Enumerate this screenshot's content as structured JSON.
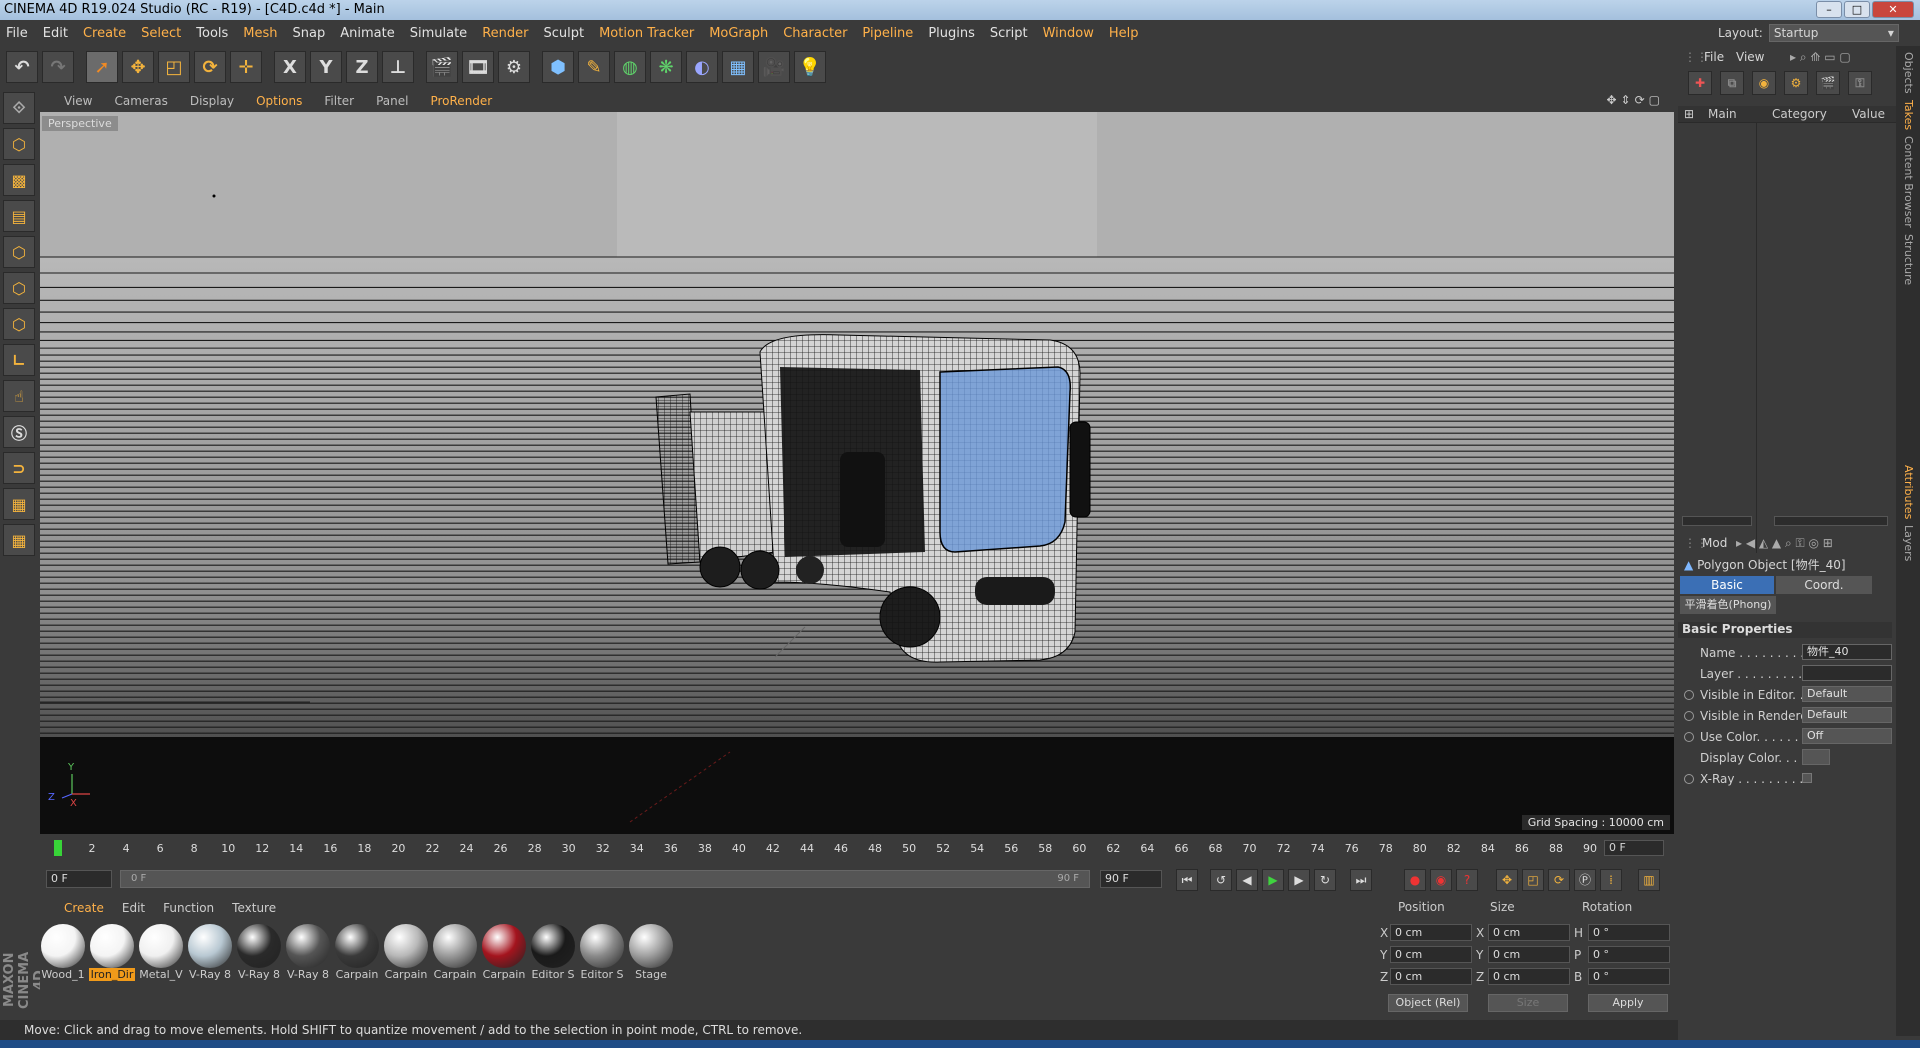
{
  "window": {
    "title": "CINEMA 4D R19.024 Studio (RC - R19) - [C4D.c4d *] - Main"
  },
  "menu": [
    "File",
    "Edit",
    "Create",
    "Select",
    "Tools",
    "Mesh",
    "Snap",
    "Animate",
    "Simulate",
    "Render",
    "Sculpt",
    "Motion Tracker",
    "MoGraph",
    "Character",
    "Pipeline",
    "Plugins",
    "Script",
    "Window",
    "Help"
  ],
  "layout": {
    "label": "Layout:",
    "value": "Startup"
  },
  "toolbar": {
    "x": "X",
    "y": "Y",
    "z": "Z"
  },
  "viewport": {
    "menu": [
      "View",
      "Cameras",
      "Display",
      "Options",
      "Filter",
      "Panel",
      "ProRender"
    ],
    "active": "Options",
    "camera_label": "Perspective",
    "grid_spacing": "Grid Spacing : 10000 cm",
    "axis_y": "Y",
    "axis_x": "X",
    "axis_z": "Z"
  },
  "timeline": {
    "ticks": [
      "0",
      "2",
      "4",
      "6",
      "8",
      "10",
      "12",
      "14",
      "16",
      "18",
      "20",
      "22",
      "24",
      "26",
      "28",
      "30",
      "32",
      "34",
      "36",
      "38",
      "40",
      "42",
      "44",
      "46",
      "48",
      "50",
      "52",
      "54",
      "56",
      "58",
      "60",
      "62",
      "64",
      "66",
      "68",
      "70",
      "72",
      "74",
      "76",
      "78",
      "80",
      "82",
      "84",
      "86",
      "88",
      "90"
    ],
    "current_frame": "0 F",
    "start": "0 F",
    "slider_start": "0 F",
    "slider_end": "90 F",
    "end": "90 F"
  },
  "materials": {
    "menu": [
      "Create",
      "Edit",
      "Function",
      "Texture"
    ],
    "active": "Create",
    "items": [
      {
        "name": "Wood_1",
        "color": "#f4f4f4"
      },
      {
        "name": "Iron_Dir",
        "color": "#f4f4f4",
        "selected": true
      },
      {
        "name": "Metal_V",
        "color": "#f0f0f0"
      },
      {
        "name": "V-Ray 8",
        "color": "#b8c8d2"
      },
      {
        "name": "V-Ray 8",
        "color": "#2a2a2a"
      },
      {
        "name": "V-Ray 8",
        "color": "#555555"
      },
      {
        "name": "Carpain",
        "color": "#3a3a3a"
      },
      {
        "name": "Carpain",
        "color": "#b8b8b8"
      },
      {
        "name": "Carpain",
        "color": "#9a9a9a"
      },
      {
        "name": "Carpain",
        "color": "#a4141e"
      },
      {
        "name": "Editor S",
        "color": "#1a1a1a"
      },
      {
        "name": "Editor S",
        "color": "#8a8a8a"
      },
      {
        "name": "Stage",
        "color": "#a0a0a0"
      }
    ]
  },
  "coords": {
    "headers": {
      "position": "Position",
      "size": "Size",
      "rotation": "Rotation"
    },
    "rows": [
      {
        "axis": "X",
        "pos": "0 cm",
        "saxis": "X",
        "size": "0 cm",
        "raxis": "H",
        "rot": "0 °"
      },
      {
        "axis": "Y",
        "pos": "0 cm",
        "saxis": "Y",
        "size": "0 cm",
        "raxis": "P",
        "rot": "0 °"
      },
      {
        "axis": "Z",
        "pos": "0 cm",
        "saxis": "Z",
        "size": "0 cm",
        "raxis": "B",
        "rot": "0 °"
      }
    ],
    "mode": "Object (Rel)",
    "size_mode": "Size",
    "apply": "Apply"
  },
  "status": "Move: Click and drag to move elements. Hold SHIFT to quantize movement / add to the selection in point mode, CTRL to remove.",
  "objects": {
    "menu": [
      "File",
      "View"
    ],
    "columns": {
      "main": "Main",
      "category": "Category",
      "value": "Value"
    }
  },
  "attributes": {
    "mode": "Mod",
    "object_title": "Polygon Object [物件_40]",
    "tabs": [
      "Basic",
      "Coord."
    ],
    "active_tab": "Basic",
    "phong_tag": "平滑着色(Phong)",
    "section": "Basic Properties",
    "fields": [
      {
        "label": "Name . . . . . . . . . . .",
        "value": "物件_40",
        "radio": false
      },
      {
        "label": "Layer . . . . . . . . . . .",
        "value": "",
        "radio": false
      },
      {
        "label": "Visible in Editor. . .",
        "value": "Default",
        "radio": true
      },
      {
        "label": "Visible in Renderer",
        "value": "Default",
        "radio": true
      },
      {
        "label": "Use Color. . . . . . . .",
        "value": "Off",
        "radio": true
      },
      {
        "label": "Display Color. . . .",
        "value": "",
        "radio": false
      },
      {
        "label": "X-Ray . . . . . . . . . .",
        "value": "",
        "radio": true
      }
    ]
  },
  "side_tabs": [
    "Objects",
    "Takes",
    "Content Browser",
    "Structure",
    "Attributes",
    "Layers"
  ]
}
